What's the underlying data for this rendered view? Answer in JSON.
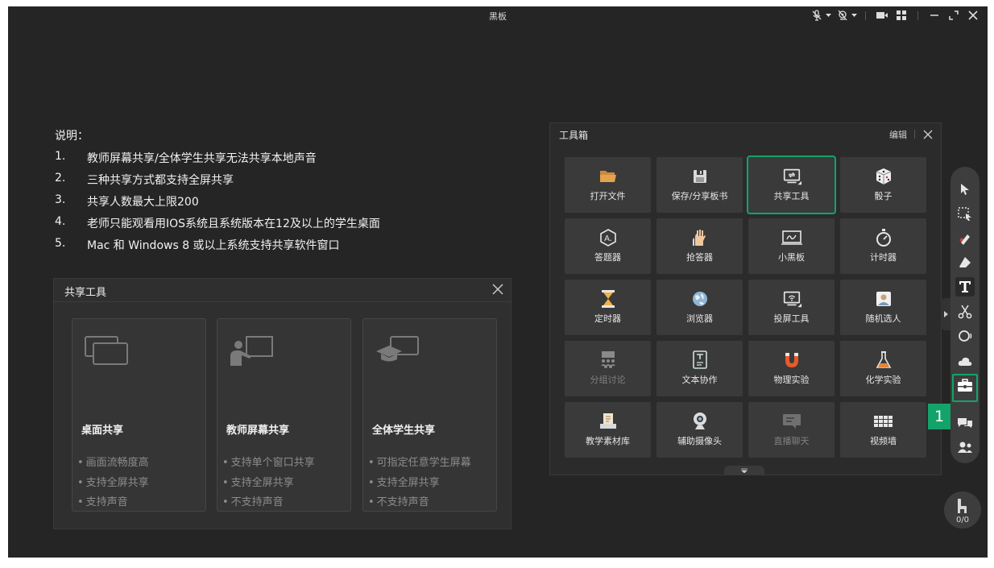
{
  "window": {
    "title": "黑板"
  },
  "notes": {
    "heading": "说明：",
    "items": [
      {
        "num": "1.",
        "text": "教师屏幕共享/全体学生共享无法共享本地声音"
      },
      {
        "num": "2.",
        "text": "三种共享方式都支持全屏共享"
      },
      {
        "num": "3.",
        "text": "共享人数最大上限200"
      },
      {
        "num": "4.",
        "text": "老师只能观看用IOS系统且系统版本在12及以上的学生桌面"
      },
      {
        "num": "5.",
        "text": "Mac 和 Windows 8 或以上系统支持共享软件窗口"
      }
    ]
  },
  "share_dialog": {
    "title": "共享工具",
    "cards": [
      {
        "title": "桌面共享",
        "bullets": [
          "画面流畅度高",
          "支持全屏共享",
          "支持声音"
        ]
      },
      {
        "title": "教师屏幕共享",
        "bullets": [
          "支持单个窗口共享",
          "支持全屏共享",
          "不支持声音"
        ]
      },
      {
        "title": "全体学生共享",
        "bullets": [
          "可指定任意学生屏幕",
          "支持全屏共享",
          "不支持声音"
        ]
      }
    ]
  },
  "toolbox": {
    "title": "工具箱",
    "edit_label": "编辑",
    "tiles": [
      {
        "label": "打开文件",
        "icon": "folder-icon"
      },
      {
        "label": "保存/分享板书",
        "icon": "save-icon"
      },
      {
        "label": "共享工具",
        "icon": "share-screen-icon"
      },
      {
        "label": "骰子",
        "icon": "dice-icon"
      },
      {
        "label": "答题器",
        "icon": "answer-icon"
      },
      {
        "label": "抢答器",
        "icon": "hands-icon"
      },
      {
        "label": "小黑板",
        "icon": "small-board-icon"
      },
      {
        "label": "计时器",
        "icon": "stopwatch-icon"
      },
      {
        "label": "定时器",
        "icon": "hourglass-icon"
      },
      {
        "label": "浏览器",
        "icon": "browser-icon"
      },
      {
        "label": "投屏工具",
        "icon": "cast-icon"
      },
      {
        "label": "随机选人",
        "icon": "random-person-icon"
      },
      {
        "label": "分组讨论",
        "icon": "group-discussion-icon"
      },
      {
        "label": "文本协作",
        "icon": "text-collab-icon"
      },
      {
        "label": "物理实验",
        "icon": "magnet-icon"
      },
      {
        "label": "化学实验",
        "icon": "flask-icon"
      },
      {
        "label": "教学素材库",
        "icon": "material-icon"
      },
      {
        "label": "辅助摄像头",
        "icon": "webcam-icon"
      },
      {
        "label": "直播聊天",
        "icon": "live-chat-icon"
      },
      {
        "label": "视频墙",
        "icon": "video-wall-icon"
      }
    ]
  },
  "badge": {
    "number": "1"
  },
  "seat": {
    "count": "0/0"
  },
  "colors": {
    "accent": "#13a36a",
    "background": "#252525",
    "panel": "#2b2b2b",
    "tile": "#3a3a3a"
  }
}
